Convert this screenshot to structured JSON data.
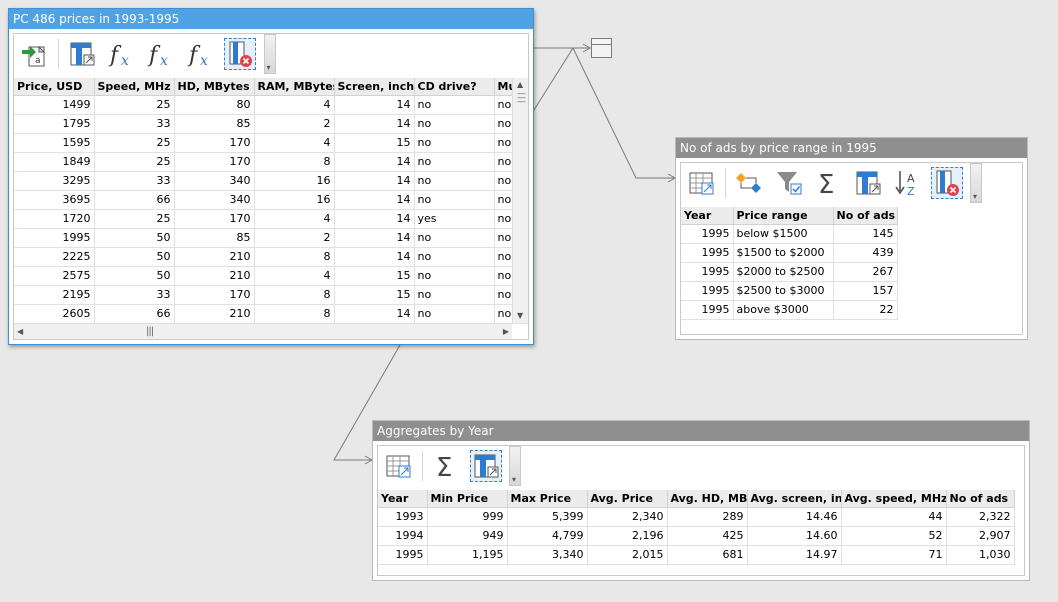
{
  "panels": {
    "prices": {
      "title": "PC 486 prices in 1993-1995",
      "columns": [
        "Price, USD",
        "Speed, MHz",
        "HD, MBytes",
        "RAM, MBytes",
        "Screen, inches",
        "CD drive?",
        "Mu"
      ],
      "rows": [
        [
          "1499",
          "25",
          "80",
          "4",
          "14",
          "no",
          "no"
        ],
        [
          "1795",
          "33",
          "85",
          "2",
          "14",
          "no",
          "no"
        ],
        [
          "1595",
          "25",
          "170",
          "4",
          "15",
          "no",
          "no"
        ],
        [
          "1849",
          "25",
          "170",
          "8",
          "14",
          "no",
          "no"
        ],
        [
          "3295",
          "33",
          "340",
          "16",
          "14",
          "no",
          "no"
        ],
        [
          "3695",
          "66",
          "340",
          "16",
          "14",
          "no",
          "no"
        ],
        [
          "1720",
          "25",
          "170",
          "4",
          "14",
          "yes",
          "no"
        ],
        [
          "1995",
          "50",
          "85",
          "2",
          "14",
          "no",
          "no"
        ],
        [
          "2225",
          "50",
          "210",
          "8",
          "14",
          "no",
          "no"
        ],
        [
          "2575",
          "50",
          "210",
          "4",
          "15",
          "no",
          "no"
        ],
        [
          "2195",
          "33",
          "170",
          "8",
          "15",
          "no",
          "no"
        ],
        [
          "2605",
          "66",
          "210",
          "8",
          "14",
          "no",
          "no"
        ]
      ]
    },
    "ads": {
      "title": "No of ads by price range in 1995",
      "columns": [
        "Year",
        "Price range",
        "No of ads"
      ],
      "rows": [
        [
          "1995",
          "below $1500",
          "145"
        ],
        [
          "1995",
          "$1500 to $2000",
          "439"
        ],
        [
          "1995",
          "$2000 to $2500",
          "267"
        ],
        [
          "1995",
          "$2500 to $3000",
          "157"
        ],
        [
          "1995",
          "above $3000",
          "22"
        ]
      ]
    },
    "aggregates": {
      "title": "Aggregates by Year",
      "columns": [
        "Year",
        "Min Price",
        "Max Price",
        "Avg. Price",
        "Avg. HD, MB",
        "Avg. screen, in.",
        "Avg. speed, MHz",
        "No of ads"
      ],
      "rows": [
        [
          "1993",
          "999",
          "5,399",
          "2,340",
          "289",
          "14.46",
          "44",
          "2,322"
        ],
        [
          "1994",
          "949",
          "4,799",
          "2,196",
          "425",
          "14.60",
          "52",
          "2,907"
        ],
        [
          "1995",
          "1,195",
          "3,340",
          "2,015",
          "681",
          "14.97",
          "71",
          "1,030"
        ]
      ]
    }
  },
  "icons": {
    "import": "import-data-icon",
    "view": "view-table-icon",
    "formula": "formula-fx-icon",
    "remove_columns": "remove-columns-icon",
    "open_table": "open-table-icon",
    "transform": "transform-icon",
    "filter": "filter-icon",
    "aggregate": "sigma-aggregate-icon",
    "sort": "sort-az-icon"
  },
  "colors": {
    "active_title": "#4fa2e3",
    "inactive_title": "#8f8f8f",
    "icon_blue": "#2f7bd0",
    "icon_red": "#e0434b",
    "icon_green": "#2d9a3c"
  }
}
